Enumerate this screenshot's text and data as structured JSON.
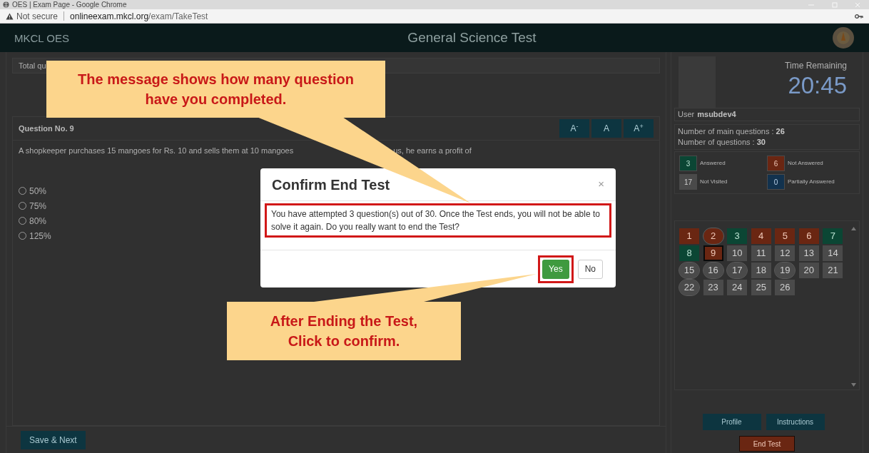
{
  "browser": {
    "title": "OES | Exam Page - Google Chrome",
    "not_secure": "Not secure",
    "url_host": "onlineexam.mkcl.org",
    "url_path": "/exam/TakeTest"
  },
  "header": {
    "logo": "MKCL OES",
    "title": "General Science Test"
  },
  "summary_bar": {
    "text": "Total qu"
  },
  "question": {
    "number": "Question No. 9",
    "font_buttons": [
      "A$^{-}$",
      "A",
      "A$^{+}$"
    ],
    "text_parts": [
      "A shopkeeper purchases 15 mangoes for Rs. 10 and sells them at 10 mangoes",
      "us, he earns a profit of"
    ],
    "options": [
      {
        "label": "50%",
        "selected": false
      },
      {
        "label": "75%",
        "selected": false
      },
      {
        "label": "80%",
        "selected": false
      },
      {
        "label": "125%",
        "selected": false
      }
    ]
  },
  "footer": {
    "save_button": "Save & Next"
  },
  "sidebar": {
    "time_label": "Time Remaining",
    "time": "20:45",
    "user_label": "User",
    "user": "msubdev4",
    "stats": [
      {
        "label": "Number of main questions : ",
        "value": "26"
      },
      {
        "label": "Number of questions : ",
        "value": "30"
      }
    ],
    "legend": [
      {
        "count": "3",
        "label": "Answered",
        "kind": "answered"
      },
      {
        "count": "6",
        "label": "Not Answered",
        "kind": "unanswered"
      },
      {
        "count": "17",
        "label": "Not Visited",
        "kind": "unvisited"
      },
      {
        "count": "0",
        "label": "Partially Answered",
        "kind": "partial"
      }
    ],
    "palette": [
      {
        "label": "1",
        "kind": "unanswered",
        "circled": false,
        "selected": false
      },
      {
        "label": "2",
        "kind": "unanswered",
        "circled": true,
        "selected": false
      },
      {
        "label": "3",
        "kind": "answered",
        "circled": false,
        "selected": false
      },
      {
        "label": "4",
        "kind": "unanswered",
        "circled": false,
        "selected": false
      },
      {
        "label": "5",
        "kind": "unanswered",
        "circled": false,
        "selected": false
      },
      {
        "label": "6",
        "kind": "unanswered",
        "circled": false,
        "selected": false
      },
      {
        "label": "7",
        "kind": "answered",
        "circled": false,
        "selected": false
      },
      {
        "label": "8",
        "kind": "answered",
        "circled": false,
        "selected": false
      },
      {
        "label": "9",
        "kind": "unanswered",
        "circled": false,
        "selected": true
      },
      {
        "label": "10",
        "kind": "unvisited",
        "circled": false,
        "selected": false
      },
      {
        "label": "11",
        "kind": "unvisited",
        "circled": false,
        "selected": false
      },
      {
        "label": "12",
        "kind": "unvisited",
        "circled": false,
        "selected": false
      },
      {
        "label": "13",
        "kind": "unvisited",
        "circled": false,
        "selected": false
      },
      {
        "label": "14",
        "kind": "unvisited",
        "circled": false,
        "selected": false
      },
      {
        "label": "15",
        "kind": "unvisited",
        "circled": true,
        "selected": false
      },
      {
        "label": "16",
        "kind": "unvisited",
        "circled": true,
        "selected": false
      },
      {
        "label": "17",
        "kind": "unvisited",
        "circled": true,
        "selected": false
      },
      {
        "label": "18",
        "kind": "unvisited",
        "circled": false,
        "selected": false
      },
      {
        "label": "19",
        "kind": "unvisited",
        "circled": true,
        "selected": false
      },
      {
        "label": "20",
        "kind": "unvisited",
        "circled": false,
        "selected": false
      },
      {
        "label": "21",
        "kind": "unvisited",
        "circled": false,
        "selected": false
      },
      {
        "label": "22",
        "kind": "unvisited",
        "circled": true,
        "selected": false
      },
      {
        "label": "23",
        "kind": "unvisited",
        "circled": false,
        "selected": false
      },
      {
        "label": "24",
        "kind": "unvisited",
        "circled": false,
        "selected": false
      },
      {
        "label": "25",
        "kind": "unvisited",
        "circled": false,
        "selected": false
      },
      {
        "label": "26",
        "kind": "unvisited",
        "circled": false,
        "selected": false
      }
    ],
    "buttons": [
      "Profile",
      "Instructions"
    ],
    "end_button": "End Test"
  },
  "dialog": {
    "title": "Confirm End Test",
    "close": "×",
    "message": "You have attempted 3 question(s) out of 30. Once the Test ends, you will not be able to solve it again. Do you really want to end the Test?",
    "message_highlighted": true,
    "buttons": [
      {
        "label": "Yes",
        "kind": "primary",
        "highlighted": true
      },
      {
        "label": "No",
        "kind": "default",
        "highlighted": false
      }
    ]
  },
  "callouts": [
    {
      "text": "The message shows how many question\nhave you completed."
    },
    {
      "text": "After Ending the Test,\nClick to confirm."
    }
  ]
}
